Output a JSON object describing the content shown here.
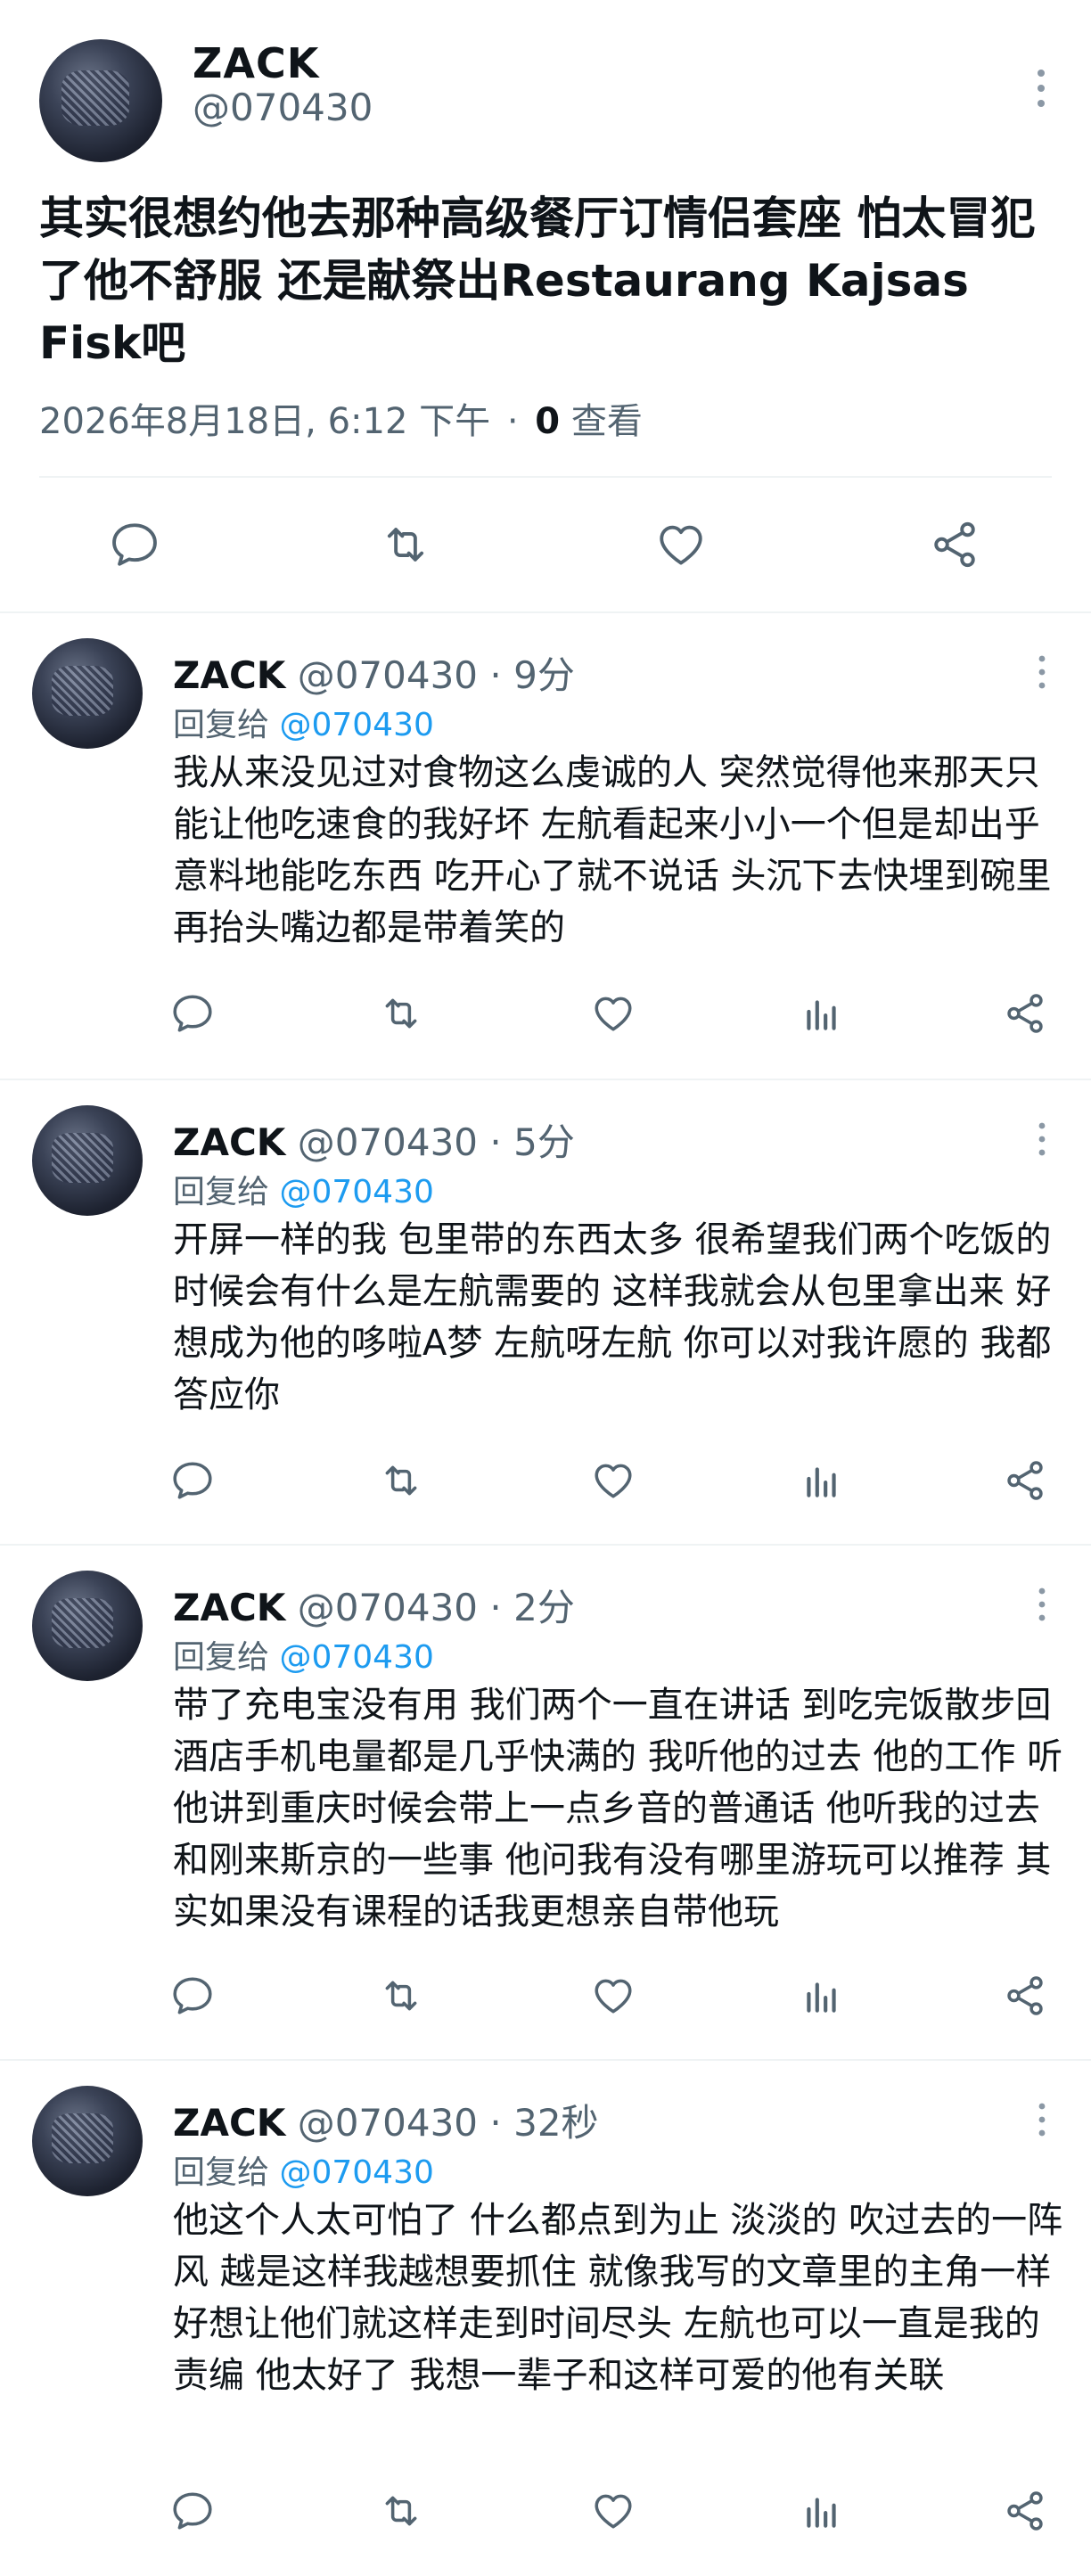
{
  "main": {
    "name": "ZACK",
    "handle": "@070430",
    "text": "其实很想约他去那种高级餐厅订情侣套座 怕太冒犯了他不舒服 还是献祭出Restaurang Kajsas Fisk吧",
    "date": "2026年8月18日, 6:12 下午",
    "dot": "·",
    "views_count": "0",
    "views_label": "查看"
  },
  "replies": [
    {
      "name": "ZACK",
      "handle": "@070430",
      "time": "9分",
      "reply_prefix": "回复给",
      "reply_to": "@070430",
      "text": "我从来没见过对食物这么虔诚的人 突然觉得他来那天只能让他吃速食的我好坏 左航看起来小小一个但是却出乎意料地能吃东西 吃开心了就不说话 头沉下去快埋到碗里 再抬头嘴边都是带着笑的"
    },
    {
      "name": "ZACK",
      "handle": "@070430",
      "time": "5分",
      "reply_prefix": "回复给",
      "reply_to": "@070430",
      "text": "开屏一样的我 包里带的东西太多 很希望我们两个吃饭的时候会有什么是左航需要的 这样我就会从包里拿出来 好想成为他的哆啦A梦 左航呀左航 你可以对我许愿的 我都答应你"
    },
    {
      "name": "ZACK",
      "handle": "@070430",
      "time": "2分",
      "reply_prefix": "回复给",
      "reply_to": "@070430",
      "text": "带了充电宝没有用 我们两个一直在讲话 到吃完饭散步回酒店手机电量都是几乎快满的 我听他的过去 他的工作 听他讲到重庆时候会带上一点乡音的普通话 他听我的过去 和刚来斯京的一些事 他问我有没有哪里游玩可以推荐 其实如果没有课程的话我更想亲自带他玩"
    },
    {
      "name": "ZACK",
      "handle": "@070430",
      "time": "32秒",
      "reply_prefix": "回复给",
      "reply_to": "@070430",
      "text": "他这个人太可怕了 什么都点到为止 淡淡的 吹过去的一阵风 越是这样我越想要抓住 就像我写的文章里的主角一样 好想让他们就这样走到时间尽头 左航也可以一直是我的责编 他太好了 我想一辈子和这样可爱的他有关联"
    }
  ],
  "colors": {
    "accent": "#1d9bf0",
    "text": "#0f1419",
    "muted": "#536471"
  },
  "icons": [
    "reply-icon",
    "retweet-icon",
    "like-icon",
    "views-icon",
    "share-icon",
    "more-icon"
  ]
}
